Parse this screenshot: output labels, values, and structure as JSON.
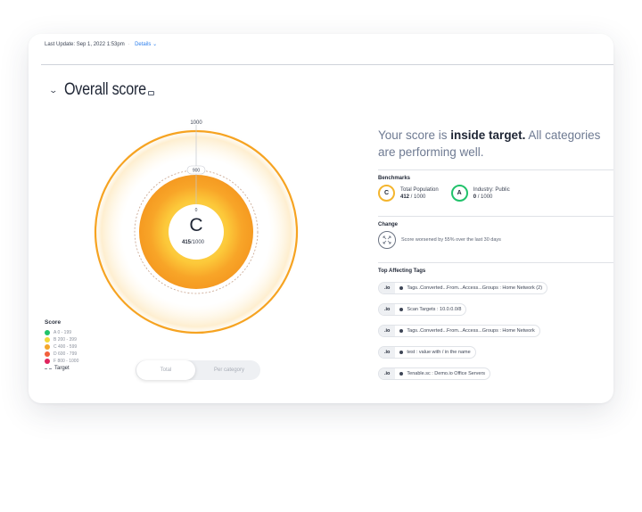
{
  "header": {
    "last_update": "Last Update: Sep 1, 2022 1:53pm",
    "separator": "·",
    "details_label": "Details ⌄"
  },
  "title": {
    "text": "Overall score",
    "collapse_icon": "chevron-down-icon",
    "info_icon": "window-icon"
  },
  "score_chart": {
    "max_label": "1000",
    "target_label": "900",
    "zero_label": "0",
    "grade": "C",
    "score": "415",
    "score_suffix": "/1000",
    "score_value": 415,
    "score_max": 1000,
    "target_value": 900
  },
  "legend": {
    "title": "Score",
    "items": [
      {
        "label": "A  0 - 199",
        "color": "#21c26b"
      },
      {
        "label": "B  200 - 399",
        "color": "#f2d83a"
      },
      {
        "label": "C  400 - 599",
        "color": "#f4a62a"
      },
      {
        "label": "D  600 - 799",
        "color": "#f2603b"
      },
      {
        "label": "F  800 - 1000",
        "color": "#e0245e"
      }
    ],
    "target_label": "Target"
  },
  "toggle": {
    "total_label": "Total",
    "per_category_label": "Per category"
  },
  "summary": {
    "prefix": "Your score is ",
    "emphasis": "inside target.",
    "suffix": " All categories are performing well."
  },
  "benchmarks": {
    "title": "Benchmarks",
    "items": [
      {
        "grade": "C",
        "label": "Total Population",
        "score": "412",
        "max": " / 1000"
      },
      {
        "grade": "A",
        "label": "Industry: Public",
        "score": "0",
        "max": " / 1000"
      }
    ]
  },
  "change": {
    "title": "Change",
    "text": "Score worsened by 55% over the last 30 days"
  },
  "tags": {
    "title": "Top Affecting Tags",
    "items": [
      {
        "prefix": ".io",
        "text": "Tags..Converted...From...Access...Groups : Home Network (2)"
      },
      {
        "prefix": ".io",
        "text": "Scan Targets : 10.0.0.0/8"
      },
      {
        "prefix": ".io",
        "text": "Tags..Converted...From...Access...Groups : Home Network"
      },
      {
        "prefix": ".io",
        "text": "test : value with / in the name"
      },
      {
        "prefix": ".io",
        "text": "Tenable.sc : Demo.io Office Servers"
      }
    ]
  },
  "colors": {
    "accent_orange": "#f6a321",
    "link_blue": "#2f80ed"
  }
}
